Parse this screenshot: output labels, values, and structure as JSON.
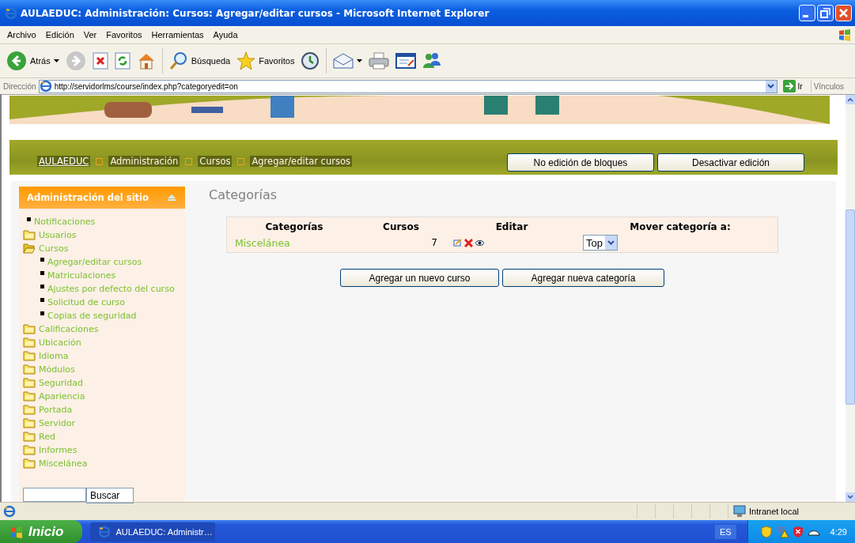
{
  "window": {
    "title": "AULAEDUC: Administración: Cursos: Agregar/editar cursos - Microsoft Internet Explorer"
  },
  "menu_bar": [
    "Archivo",
    "Edición",
    "Ver",
    "Favoritos",
    "Herramientas",
    "Ayuda"
  ],
  "toolbar": {
    "back_label": "Atrás",
    "search_label": "Búsqueda",
    "favorites_label": "Favoritos"
  },
  "address_bar": {
    "label": "Dirección",
    "url": "http://servidorlms/course/index.php?categoryedit=on",
    "go_label": "Ir",
    "links_label": "Vínculos"
  },
  "breadcrumb": [
    {
      "label": "AULAEDUC",
      "link": true
    },
    {
      "label": "Administración",
      "link": false
    },
    {
      "label": "Cursos",
      "link": false
    },
    {
      "label": "Agregar/editar cursos",
      "link": false
    }
  ],
  "edit_buttons": [
    "No edición de bloques",
    "Desactivar edición"
  ],
  "sidebar": {
    "title": "Administración del sitio",
    "items": [
      {
        "label": "Notificaciones",
        "kind": "page"
      },
      {
        "label": "Usuarios",
        "kind": "folder",
        "expanded": false
      },
      {
        "label": "Cursos",
        "kind": "folder",
        "expanded": true,
        "children": [
          {
            "label": "Agregar/editar cursos",
            "kind": "page"
          },
          {
            "label": "Matriculaciones",
            "kind": "page"
          },
          {
            "label": "Ajustes por defecto del curso",
            "kind": "page"
          },
          {
            "label": "Solicitud de curso",
            "kind": "page"
          },
          {
            "label": "Copias de seguridad",
            "kind": "page"
          }
        ]
      },
      {
        "label": "Calificaciones",
        "kind": "folder",
        "expanded": false
      },
      {
        "label": "Ubicación",
        "kind": "folder",
        "expanded": false
      },
      {
        "label": "Idioma",
        "kind": "folder",
        "expanded": false
      },
      {
        "label": "Módulos",
        "kind": "folder",
        "expanded": false
      },
      {
        "label": "Seguridad",
        "kind": "folder",
        "expanded": false
      },
      {
        "label": "Apariencia",
        "kind": "folder",
        "expanded": false
      },
      {
        "label": "Portada",
        "kind": "folder",
        "expanded": false
      },
      {
        "label": "Servidor",
        "kind": "folder",
        "expanded": false
      },
      {
        "label": "Red",
        "kind": "folder",
        "expanded": false
      },
      {
        "label": "Informes",
        "kind": "folder",
        "expanded": false
      },
      {
        "label": "Miscelánea",
        "kind": "folder",
        "expanded": false
      }
    ],
    "search_button": "Buscar"
  },
  "main": {
    "heading": "Categorías",
    "table": {
      "columns": [
        "Categorías",
        "Cursos",
        "Editar",
        "Mover categoría a:"
      ],
      "rows": [
        {
          "name": "Miscelánea",
          "courses": "7",
          "move_to": "Top"
        }
      ]
    },
    "buttons": [
      "Agregar un nuevo curso",
      "Agregar nueva categoría"
    ]
  },
  "status_bar": {
    "zone": "Intranet local"
  },
  "taskbar": {
    "start": "Inicio",
    "tasks": [
      "AULAEDUC: Administr…"
    ],
    "language": "ES",
    "clock": "4:29"
  }
}
